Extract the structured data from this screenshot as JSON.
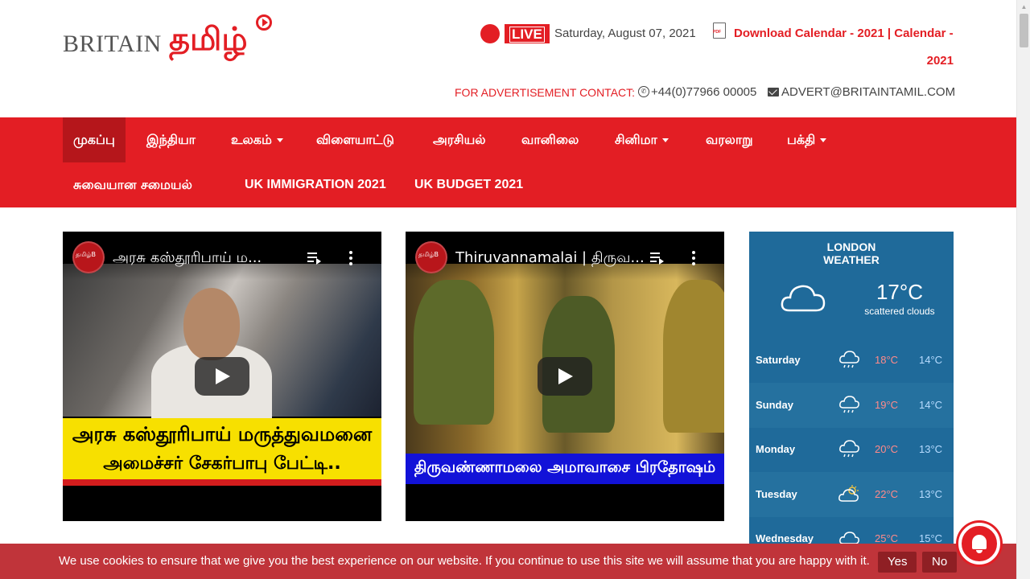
{
  "header": {
    "logo_britain": "BRITAIN",
    "logo_tamil": "தமிழ்",
    "live_label": "LIVE",
    "date": "Saturday, August 07, 2021",
    "calendar_line1": "Download Calendar - 2021 | Calendar -",
    "calendar_line2": "2021",
    "ad_label": "FOR ADVERTISEMENT CONTACT:",
    "phone": "+44(0)77966 00005",
    "email": "ADVERT@BRITAINTAMIL.COM"
  },
  "nav": {
    "items": [
      {
        "label": "முகப்பு"
      },
      {
        "label": "இந்தியா"
      },
      {
        "label": "உலகம்"
      },
      {
        "label": "விளையாட்டு"
      },
      {
        "label": "அரசியல்"
      },
      {
        "label": "வானிலை"
      },
      {
        "label": "சினிமா"
      },
      {
        "label": "வரலாறு"
      },
      {
        "label": "பக்தி"
      },
      {
        "label": "சுவையான சமையல்"
      },
      {
        "label": "UK IMMIGRATION 2021"
      },
      {
        "label": "UK BUDGET 2021"
      }
    ]
  },
  "videos": [
    {
      "title": "அரசு கஸ்தூரிபாய் ம...",
      "caption_line1": "அரசு கஸ்தூரிபாய் மருத்துவமனை",
      "caption_line2": "அமைச்சர் சேகர்பாபு பேட்டி.."
    },
    {
      "title": "Thiruvannamalai | திருவ...",
      "caption_line1": "திருவண்ணாமலை அமாவாசை பிரதோஷம்"
    }
  ],
  "weather": {
    "city": "LONDON",
    "label": "WEATHER",
    "temp": "17°C",
    "desc": "scattered clouds",
    "days": [
      {
        "name": "Saturday",
        "hi": "18°C",
        "lo": "14°C",
        "icon": "rain-cloud-icon"
      },
      {
        "name": "Sunday",
        "hi": "19°C",
        "lo": "14°C",
        "icon": "rain-cloud-icon"
      },
      {
        "name": "Monday",
        "hi": "20°C",
        "lo": "13°C",
        "icon": "rain-cloud-icon"
      },
      {
        "name": "Tuesday",
        "hi": "22°C",
        "lo": "13°C",
        "icon": "sun-cloud-icon"
      },
      {
        "name": "Wednesday",
        "hi": "25°C",
        "lo": "15°C",
        "icon": "cloud-icon"
      }
    ]
  },
  "cookie": {
    "text": "We use cookies to ensure that we give you the best experience on our website. If you continue to use this site we will assume that you are happy with it.",
    "yes": "Yes",
    "no": "No"
  },
  "colors": {
    "brand_red": "#e31e24",
    "weather_blue": "#1f6a9a",
    "cookie_red": "#c0343a"
  }
}
